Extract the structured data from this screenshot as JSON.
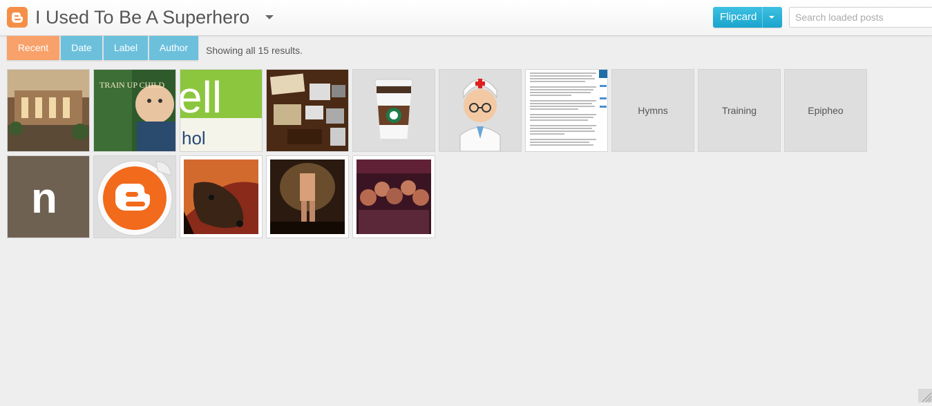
{
  "header": {
    "blog_title": "I Used To Be A Superhero",
    "view_button": "Flipcard",
    "search_placeholder": "Search loaded posts"
  },
  "tabs": [
    {
      "label": "Recent",
      "active": true
    },
    {
      "label": "Date",
      "active": false
    },
    {
      "label": "Label",
      "active": false
    },
    {
      "label": "Author",
      "active": false
    }
  ],
  "results_text": "Showing all 15 results.",
  "cards": [
    {
      "type": "image",
      "icon": "building-photo"
    },
    {
      "type": "image",
      "icon": "book-cover-photo",
      "text": "TRAIN UP CHILD"
    },
    {
      "type": "image",
      "icon": "ell-logo-image",
      "text": "ell",
      "subtext": "hol"
    },
    {
      "type": "image",
      "icon": "calendar-collage-photo"
    },
    {
      "type": "image",
      "icon": "coffee-cup-icon"
    },
    {
      "type": "image",
      "icon": "doctor-avatar-icon"
    },
    {
      "type": "image",
      "icon": "document-screenshot"
    },
    {
      "type": "text",
      "label": "Hymns"
    },
    {
      "type": "text",
      "label": "Training"
    },
    {
      "type": "text",
      "label": "Epipheo"
    },
    {
      "type": "image",
      "icon": "n-logo-image",
      "text": "n"
    },
    {
      "type": "image",
      "icon": "blogger-sticker-icon"
    },
    {
      "type": "image",
      "icon": "dog-photo"
    },
    {
      "type": "image",
      "icon": "figure-photo"
    },
    {
      "type": "image",
      "icon": "group-photo"
    }
  ],
  "colors": {
    "accent_blue": "#6cc0dc",
    "accent_orange": "#f9a16a",
    "button_blue": "#1aa4cd",
    "blogger_orange": "#f58f48"
  }
}
